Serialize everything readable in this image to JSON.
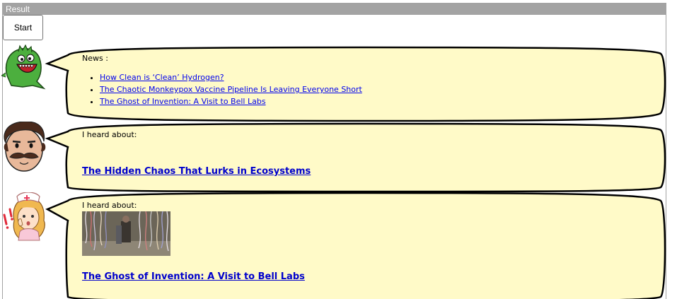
{
  "panel": {
    "title": "Result"
  },
  "toolbar": {
    "start_label": "Start"
  },
  "bubbles": [
    {
      "avatar": "green-monster-icon",
      "intro": "News :",
      "items": [
        "How Clean is ‘Clean’ Hydrogen?",
        "The Chaotic Monkeypox Vaccine Pipeline Is Leaving Everyone Short",
        "The Ghost of Invention: A Visit to Bell Labs"
      ]
    },
    {
      "avatar": "mustache-man-icon",
      "intro": "I heard about:",
      "headline": "The Hidden Chaos That Lurks in Ecosystems"
    },
    {
      "avatar": "nurse-icon",
      "intro": "I heard about:",
      "image": "bell-labs-photo",
      "headline": "The Ghost of Invention: A Visit to Bell Labs"
    }
  ],
  "colors": {
    "bubble_fill": "#fffac8",
    "bubble_stroke": "#000000",
    "header_bg": "#a3a3a3",
    "link": "#0000ee"
  }
}
